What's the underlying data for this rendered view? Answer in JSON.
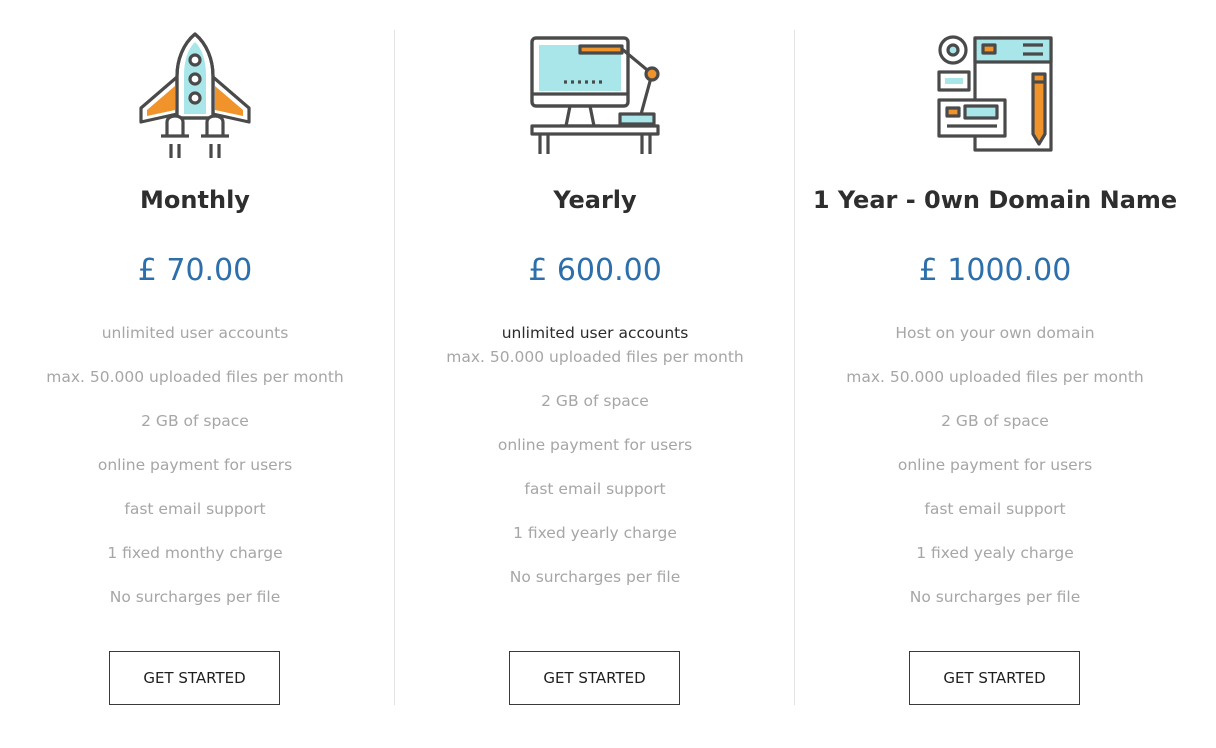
{
  "colors": {
    "price": "#2d6faa",
    "title": "#2e2e2e",
    "feature_text": "#a6a6a6",
    "icon_cyan": "#a9e6ea",
    "icon_orange": "#f0932b",
    "icon_outline": "#4a4a4a"
  },
  "plans": [
    {
      "icon": "rocket-icon",
      "title": "Monthly",
      "price": "£ 70.00",
      "features": [
        "unlimited user accounts",
        "max. 50.000 uploaded files per month",
        "2 GB of space",
        "online payment for users",
        "fast email support",
        "1 fixed monthy charge",
        "No surcharges per file"
      ],
      "cta": "GET STARTED"
    },
    {
      "icon": "desktop-workstation-icon",
      "title": "Yearly",
      "price": "£ 600.00",
      "features": [
        "unlimited user accounts",
        "max. 50.000 uploaded files per month",
        "2 GB of space",
        "online payment for users",
        "fast email support",
        "1 fixed yearly charge",
        "No surcharges per file"
      ],
      "cta": "GET STARTED"
    },
    {
      "icon": "web-design-icon",
      "title": "1 Year - 0wn Domain Name",
      "price": "£ 1000.00",
      "features": [
        "Host on your own domain",
        "max. 50.000 uploaded files per month",
        "2 GB of space",
        "online payment for users",
        "fast email support",
        "1 fixed yealy charge",
        "No surcharges per file"
      ],
      "cta": "GET STARTED"
    }
  ]
}
